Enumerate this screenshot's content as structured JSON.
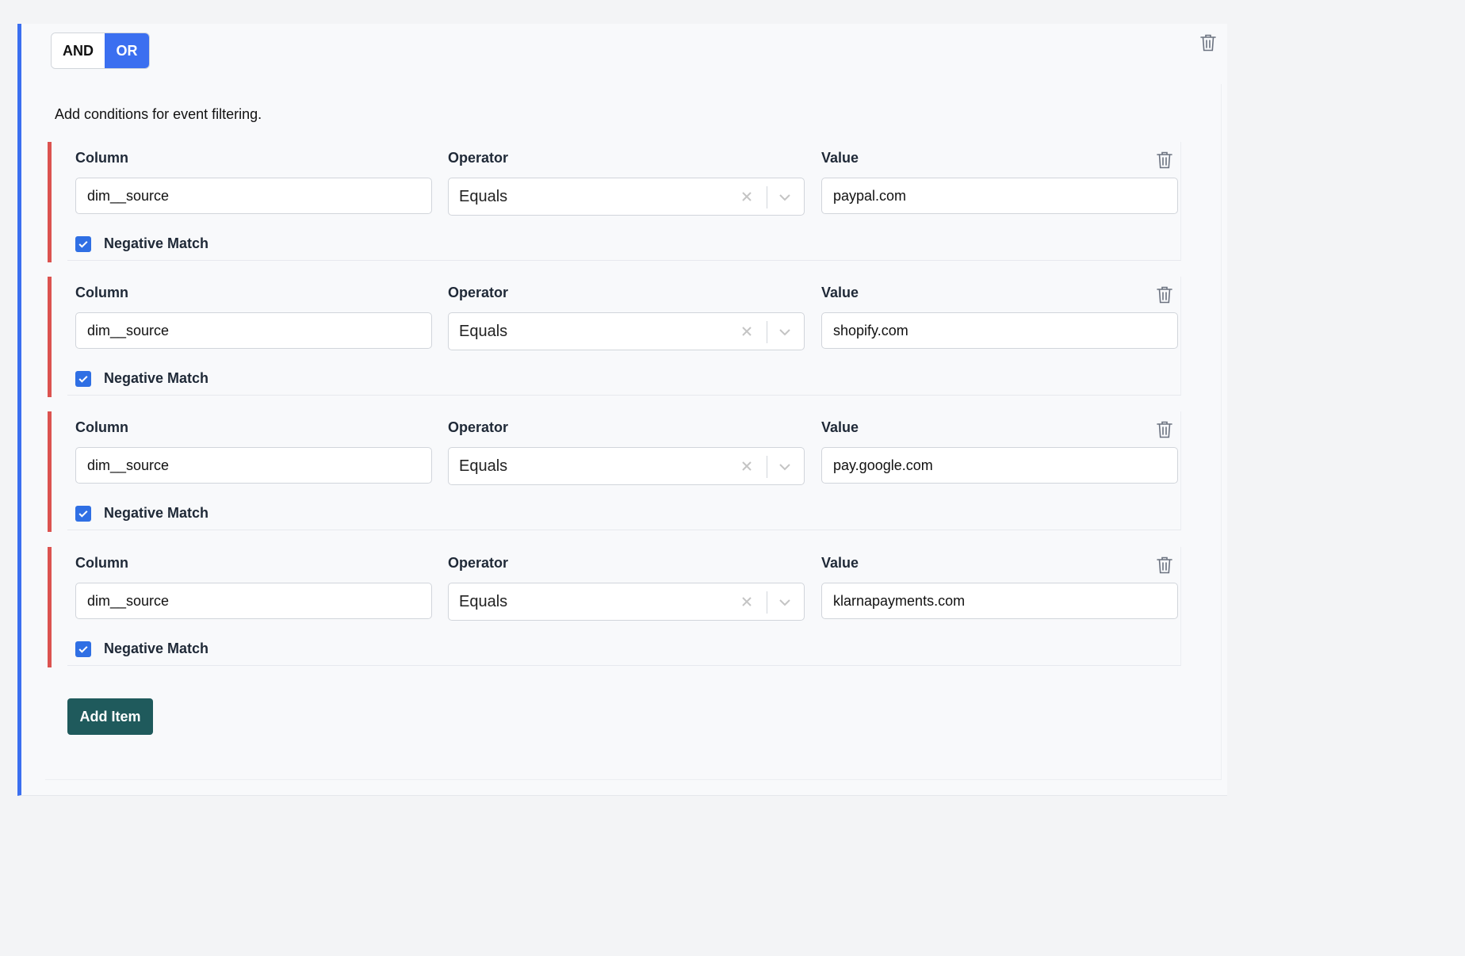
{
  "logic_toggle": {
    "options": [
      "AND",
      "OR"
    ],
    "selected": "OR",
    "accent_color": "#3b6ff0"
  },
  "description": "Add conditions for event filtering.",
  "labels": {
    "column": "Column",
    "operator": "Operator",
    "value": "Value",
    "negative_match": "Negative Match"
  },
  "conditions": [
    {
      "column": "dim__source",
      "operator": "Equals",
      "value": "paypal.com",
      "negative_match": true
    },
    {
      "column": "dim__source",
      "operator": "Equals",
      "value": "shopify.com",
      "negative_match": true
    },
    {
      "column": "dim__source",
      "operator": "Equals",
      "value": "pay.google.com",
      "negative_match": true
    },
    {
      "column": "dim__source",
      "operator": "Equals",
      "value": "klarnapayments.com",
      "negative_match": true
    }
  ],
  "add_item_label": "Add Item",
  "icons": {
    "delete": "trash-icon",
    "clear": "close-icon",
    "dropdown": "chevron-down-icon",
    "checkbox": "check-icon"
  },
  "colors": {
    "condition_accent": "#dc5350",
    "add_button": "#1f5a5c",
    "checkbox": "#2f6fe4"
  }
}
